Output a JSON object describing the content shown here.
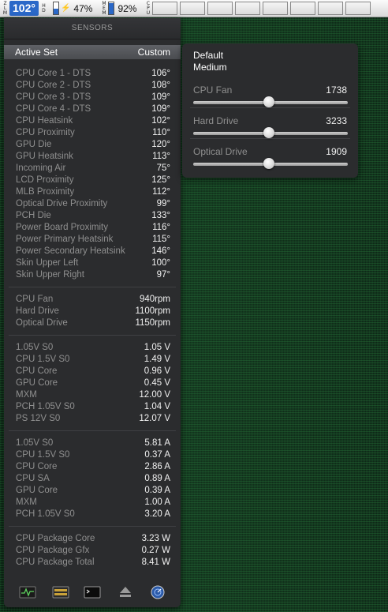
{
  "menubar": {
    "temp_tag": [
      "Z",
      "L",
      "M"
    ],
    "temp": "102°",
    "hd_tag": [
      "H",
      "D"
    ],
    "battery_percent": "47%",
    "battery_fill_fraction": 0.47,
    "mem_tag": [
      "M",
      "E",
      "M"
    ],
    "mem_percent": "92%",
    "mem_fill_fraction": 0.92,
    "cpu_tag": [
      "C",
      "P",
      "U"
    ],
    "cpu_cells": 8
  },
  "panel": {
    "title": "SENSORS",
    "active_set": {
      "label": "Active Set",
      "value": "Custom"
    },
    "groups": [
      {
        "rows": [
          {
            "name": "CPU Core 1 - DTS",
            "value": "106°"
          },
          {
            "name": "CPU Core 2 - DTS",
            "value": "108°"
          },
          {
            "name": "CPU Core 3 - DTS",
            "value": "109°"
          },
          {
            "name": "CPU Core 4 - DTS",
            "value": "109°"
          },
          {
            "name": "CPU Heatsink",
            "value": "102°"
          },
          {
            "name": "CPU Proximity",
            "value": "110°"
          },
          {
            "name": "GPU Die",
            "value": "120°"
          },
          {
            "name": "GPU Heatsink",
            "value": "113°"
          },
          {
            "name": "Incoming Air",
            "value": "75°"
          },
          {
            "name": "LCD Proximity",
            "value": "125°"
          },
          {
            "name": "MLB Proximity",
            "value": "112°"
          },
          {
            "name": "Optical Drive Proximity",
            "value": "99°"
          },
          {
            "name": "PCH Die",
            "value": "133°"
          },
          {
            "name": "Power Board Proximity",
            "value": "116°"
          },
          {
            "name": "Power Primary Heatsink",
            "value": "115°"
          },
          {
            "name": "Power Secondary Heatsink",
            "value": "146°"
          },
          {
            "name": "Skin Upper Left",
            "value": "100°"
          },
          {
            "name": "Skin Upper Right",
            "value": "97°"
          }
        ]
      },
      {
        "rows": [
          {
            "name": "CPU Fan",
            "value": "940rpm"
          },
          {
            "name": "Hard Drive",
            "value": "1100rpm"
          },
          {
            "name": "Optical Drive",
            "value": "1150rpm"
          }
        ]
      },
      {
        "rows": [
          {
            "name": "1.05V S0",
            "value": "1.05 V"
          },
          {
            "name": "CPU 1.5V S0",
            "value": "1.49 V"
          },
          {
            "name": "CPU Core",
            "value": "0.96 V"
          },
          {
            "name": "GPU Core",
            "value": "0.45 V"
          },
          {
            "name": "MXM",
            "value": "12.00 V"
          },
          {
            "name": "PCH 1.05V S0",
            "value": "1.04 V"
          },
          {
            "name": "PS 12V S0",
            "value": "12.07 V"
          }
        ]
      },
      {
        "rows": [
          {
            "name": "1.05V S0",
            "value": "5.81 A"
          },
          {
            "name": "CPU 1.5V S0",
            "value": "0.37 A"
          },
          {
            "name": "CPU Core",
            "value": "2.86 A"
          },
          {
            "name": "CPU SA",
            "value": "0.89 A"
          },
          {
            "name": "GPU Core",
            "value": "0.39 A"
          },
          {
            "name": "MXM",
            "value": "1.00 A"
          },
          {
            "name": "PCH 1.05V S0",
            "value": "3.20 A"
          }
        ]
      },
      {
        "rows": [
          {
            "name": "CPU Package Core",
            "value": "3.23 W"
          },
          {
            "name": "CPU Package Gfx",
            "value": "0.27 W"
          },
          {
            "name": "CPU Package Total",
            "value": "8.41 W"
          }
        ]
      }
    ],
    "bottom_icons": [
      "activity-monitor-icon",
      "istat-icon",
      "terminal-icon",
      "eject-icon",
      "network-utility-icon"
    ]
  },
  "fan_popup": {
    "presets": [
      "Default",
      "Medium"
    ],
    "fans": [
      {
        "name": "CPU Fan",
        "value": "1738",
        "slider_fraction": 0.49
      },
      {
        "name": "Hard Drive",
        "value": "3233",
        "slider_fraction": 0.49
      },
      {
        "name": "Optical Drive",
        "value": "1909",
        "slider_fraction": 0.49
      }
    ]
  },
  "colors": {
    "accent": "#2a68c8",
    "panel_bg": "#2b2c2e",
    "label_text": "#8f8f8f",
    "value_text": "#f0f0f0"
  }
}
